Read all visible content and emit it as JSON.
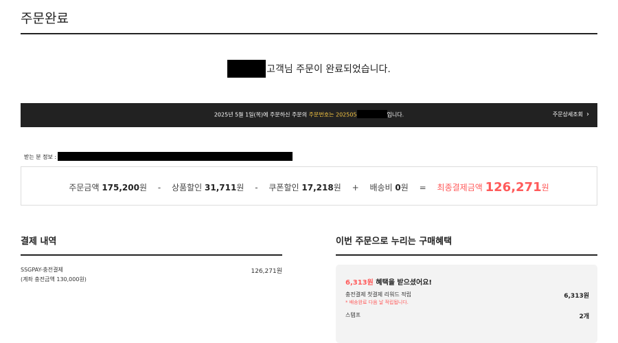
{
  "page": {
    "title": "주문완료"
  },
  "headline": {
    "suffix": "고객님 주문이 완료되었습니다."
  },
  "order_bar": {
    "text_before": "2025년 5월 1일(목)에 주문하신 주문의 ",
    "order_no_label": "주문번호는 20250",
    "order_no_partial": "5",
    "text_after": "입니다.",
    "detail_link": "주문상세조회",
    "detail_icon": "chevron-right-icon"
  },
  "recipient": {
    "label": "받는 분 정보 :"
  },
  "summary": {
    "order_amount_label": "주문금액",
    "order_amount": "175,200",
    "product_discount_label": "상품할인",
    "product_discount": "31,711",
    "coupon_discount_label": "쿠폰할인",
    "coupon_discount": "17,218",
    "shipping_label": "배송비",
    "shipping": "0",
    "final_label": "최종결제금액",
    "final_amount": "126,271",
    "unit": "원",
    "op_minus": "-",
    "op_plus": "+",
    "op_equals": "="
  },
  "payment": {
    "title": "결제 내역",
    "method": "SSGPAY-충전결제",
    "sub": "(계좌 충전금액 130,000원)",
    "amount": "126,271원"
  },
  "benefits": {
    "title": "이번 주문으로 누리는 구매혜택",
    "head_amount": "6,313원",
    "head_text": " 혜택을 받으셨어요!",
    "row1_label": "충전결제 첫결제 리워드 적립",
    "row1_note": "* 배송완료 다음 날 적립됩니다.",
    "row1_value": "6,313원",
    "row2_label": "스탬프",
    "row2_value": "2개"
  },
  "colors": {
    "accent_red": "#ff5a5a",
    "order_highlight": "#f5c542",
    "dark_bar": "#222222"
  }
}
